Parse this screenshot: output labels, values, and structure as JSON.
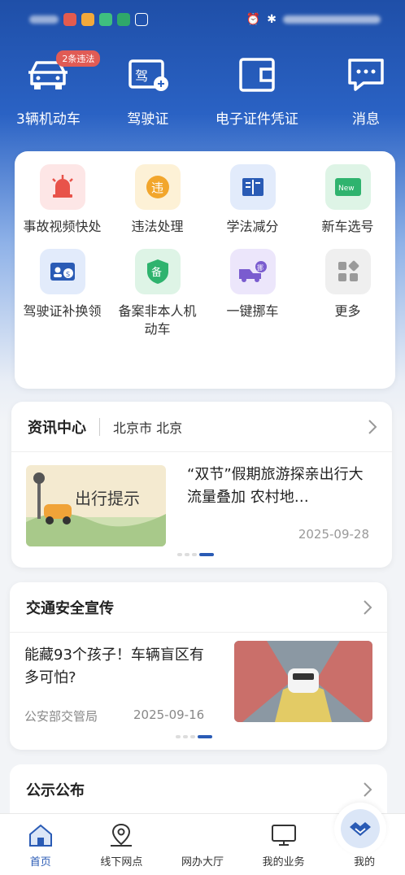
{
  "topnav": {
    "vehicles_label": "3辆机动车",
    "vehicles_badge": "2条违法",
    "license_label": "驾驶证",
    "econtract_label": "电子证件凭证",
    "message_label": "消息"
  },
  "services": [
    {
      "label": "事故视频快处",
      "icon": "alarm-light-icon",
      "bg": "#fde6e6"
    },
    {
      "label": "违法处理",
      "icon": "violation-icon",
      "bg": "#fdf1d6"
    },
    {
      "label": "学法减分",
      "icon": "book-icon",
      "bg": "#e2ebfb"
    },
    {
      "label": "新车选号",
      "icon": "new-plate-icon",
      "bg": "#def4e6"
    },
    {
      "label": "驾驶证补换领",
      "icon": "license-renew-icon",
      "bg": "#e2ebfb"
    },
    {
      "label": "备案非本人机动车",
      "icon": "record-shield-icon",
      "bg": "#def4e6"
    },
    {
      "label": "一键挪车",
      "icon": "move-car-icon",
      "bg": "#ece6fb"
    },
    {
      "label": "更多",
      "icon": "more-grid-icon",
      "bg": "#efefef"
    }
  ],
  "news": {
    "title": "资讯中心",
    "city": "北京市 北京",
    "headline": "“双节”假期旅游探亲出行大流量叠加 农村地…",
    "date": "2025-09-28",
    "image_caption": "出行提示"
  },
  "safety": {
    "title": "交通安全宣传",
    "headline": "能藏93个孩子！车辆盲区有多可怕?",
    "source": "公安部交管局",
    "date": "2025-09-16"
  },
  "notice": {
    "title": "公示公布"
  },
  "tabbar": {
    "home": "首页",
    "offline": "线下网点",
    "online_hall": "网办大厅",
    "my_business": "我的业务",
    "mine": "我的"
  },
  "colors": {
    "brand_blue": "#2a5bb5",
    "badge_red": "#e05b55"
  }
}
